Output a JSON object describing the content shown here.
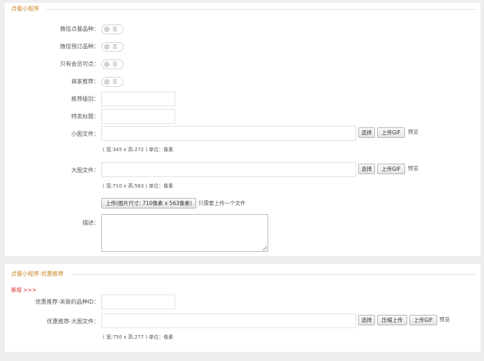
{
  "section1": {
    "title": "点餐小程序",
    "wechat_order_label": "微信点餐品种：",
    "wechat_order_toggle": "否",
    "wechat_reserve_label": "微信预订品种：",
    "wechat_reserve_toggle": "否",
    "member_only_label": "只有会员可点：",
    "member_only_toggle": "否",
    "merchant_recommend_label": "商家推荐：",
    "merchant_recommend_toggle": "否",
    "recommend_level_label": "推荐级别：",
    "recommend_level_value": "",
    "special_title_label": "特卖标题：",
    "special_title_value": "",
    "small_image_label": "小图文件：",
    "small_image_value": "",
    "small_image_hint": "( 宽:345 x 高:272 ) 单位：像素",
    "large_image_label": "大图文件：",
    "large_image_value": "",
    "large_image_hint": "( 宽:710 x 高:563 ) 单位：像素",
    "select_label": "选择",
    "upload_gif_label": "上传GIF",
    "preview_label": "预览",
    "upload_size_label": "上传(图片尺寸: 710像素 x 563像素)",
    "upload_note": "只需要上传一个文件",
    "description_label": "描述：",
    "description_value": ""
  },
  "section2": {
    "title": "点餐小程序-优惠推荐",
    "new_link": "新增 >>>",
    "linked_id_label": "优惠推荐-关联的品种ID：",
    "linked_id_value": "",
    "large_image_label": "优惠推荐-大图文件：",
    "large_image_value": "",
    "select_label": "选择",
    "compress_upload_label": "压缩上传",
    "upload_gif_label": "上传GIF",
    "preview_label": "预览",
    "image_hint": "( 宽:750 x 高:277 ) 单位：像素"
  }
}
